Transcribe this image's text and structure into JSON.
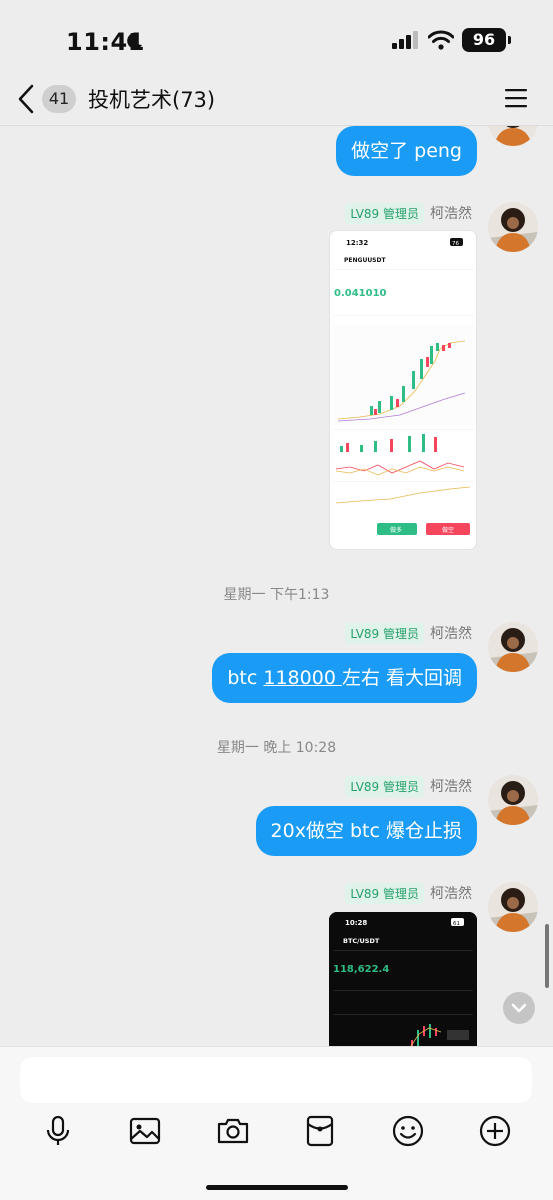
{
  "status_bar": {
    "time": "11:41",
    "battery": "96"
  },
  "nav": {
    "unread_count": "41",
    "title": "投机艺术(73)"
  },
  "sender": {
    "level": "LV89 管理员",
    "name": "柯浩然"
  },
  "messages": {
    "m1_text": "做空了 peng",
    "m3_prefix": "btc ",
    "m3_link": "118000 ",
    "m3_suffix": "左右 看大回调",
    "m4_text": "20x做空 btc 爆仓止损"
  },
  "timestamps": {
    "t1": "星期一 下午1:13",
    "t2": "星期一 晚上 10:28"
  },
  "screenshot1": {
    "time": "12:32",
    "battery": "76",
    "pair": "PENGUUSDT",
    "price": "0.041010",
    "long": "做多",
    "short": "做空"
  },
  "screenshot2": {
    "time": "10:28",
    "battery": "61",
    "pair": "BTC/USDT",
    "price": "118,622.4"
  },
  "colors": {
    "bubble": "#1a9bf5",
    "level_badge_bg": "#dff3ea",
    "level_badge_text": "#26a06a",
    "long_green": "#2ebd85",
    "short_red": "#f6465d"
  },
  "icons": [
    "moon-icon",
    "signal-icon",
    "wifi-icon",
    "back-icon",
    "menu-icon",
    "mic-icon",
    "image-icon",
    "camera-icon",
    "red-packet-icon",
    "emoji-icon",
    "plus-icon",
    "chevron-down-icon"
  ]
}
